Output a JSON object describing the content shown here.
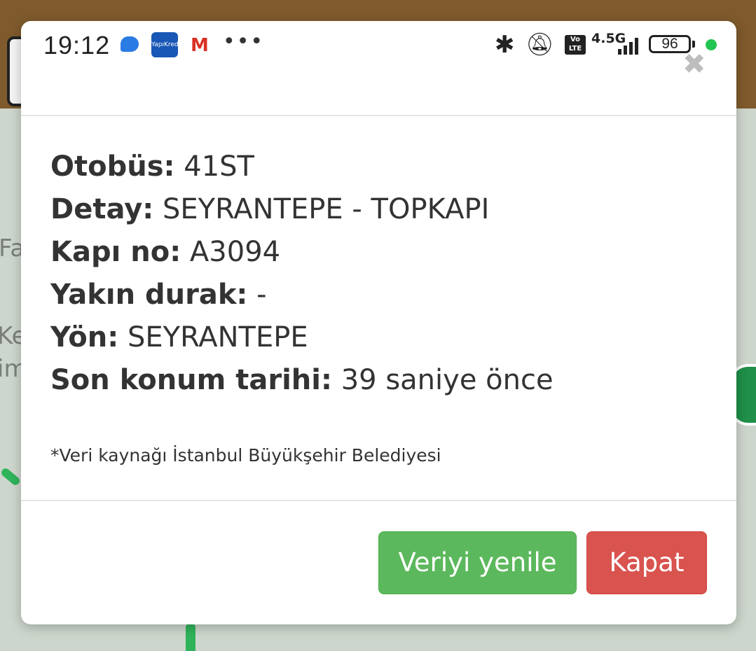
{
  "status_bar": {
    "time": "19:12",
    "bank_label": "YapıKredi",
    "gmail_label": "M",
    "more_label": "•••",
    "volte_label": "Vo\nLTE",
    "network_label": "4.5G",
    "battery_level": "96"
  },
  "background": {
    "map_text_1": "Fa",
    "map_text_2": "Ke",
    "map_text_3": "im"
  },
  "modal": {
    "close_symbol": "✖",
    "fields": [
      {
        "label": "Otobüs:",
        "value": " 41ST"
      },
      {
        "label": "Detay:",
        "value": " SEYRANTEPE - TOPKAPI"
      },
      {
        "label": "Kapı no:",
        "value": " A3094"
      },
      {
        "label": "Yakın durak:",
        "value": " -"
      },
      {
        "label": "Yön:",
        "value": " SEYRANTEPE"
      },
      {
        "label": "Son konum tarihi:",
        "value": " 39 saniye önce"
      }
    ],
    "source_note": "*Veri kaynağı İstanbul Büyükşehir Belediyesi",
    "refresh_button": "Veriyi yenile",
    "close_button": "Kapat"
  },
  "colors": {
    "header_brown": "#7e5a2c",
    "refresh_green": "#5cb85c",
    "close_red": "#d9534f",
    "status_dot_green": "#23c552"
  },
  "icons": [
    "messages-icon",
    "bank-app-icon",
    "gmail-icon",
    "more-icon",
    "bluetooth-icon",
    "mute-icon",
    "volte-icon",
    "signal-icon",
    "battery-icon"
  ]
}
